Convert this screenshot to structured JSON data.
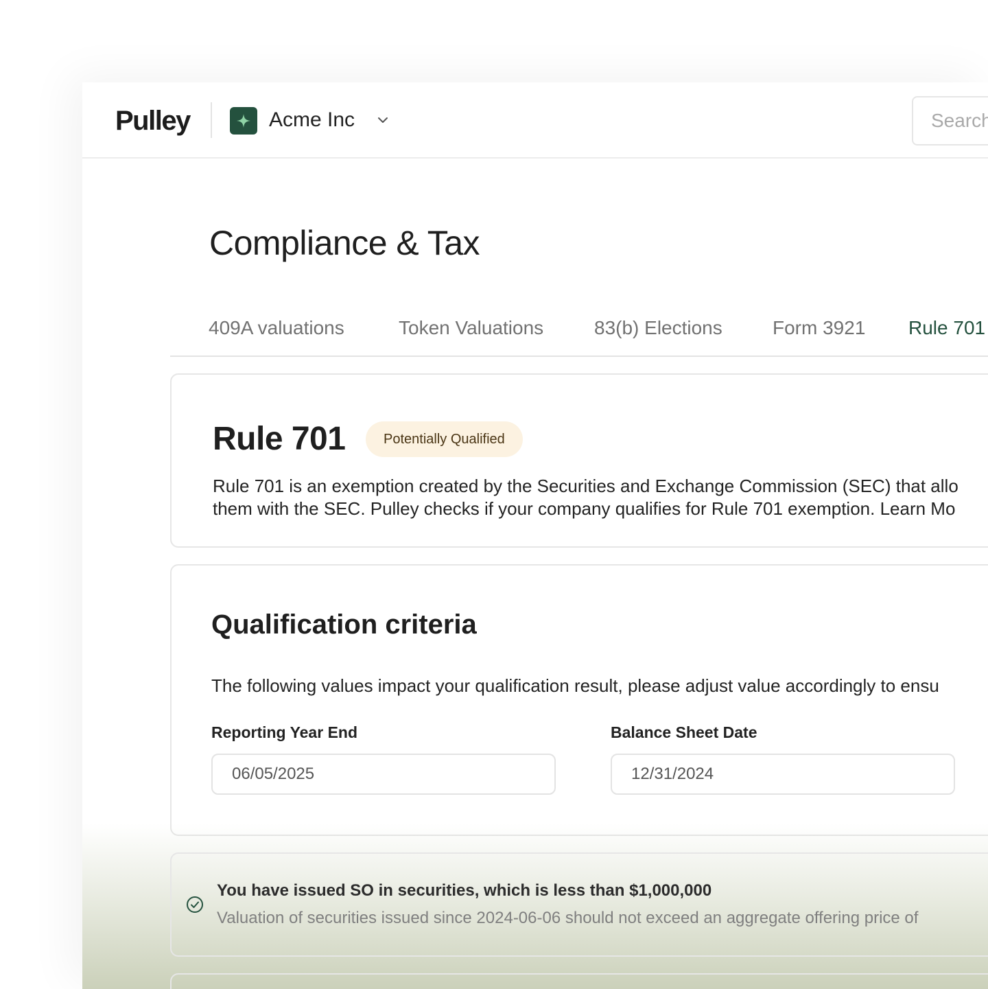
{
  "header": {
    "logo": "Pulley",
    "org_name": "Acme Inc",
    "search_placeholder": "Search"
  },
  "page": {
    "title": "Compliance & Tax"
  },
  "tabs": [
    {
      "label": "409A valuations",
      "active": false
    },
    {
      "label": "Token Valuations",
      "active": false
    },
    {
      "label": "83(b) Elections",
      "active": false
    },
    {
      "label": "Form 3921",
      "active": false
    },
    {
      "label": "Rule 701",
      "active": true
    }
  ],
  "rule_card": {
    "title": "Rule 701",
    "status_badge": "Potentially Qualified",
    "description_line1": "Rule 701 is an exemption created by the Securities and Exchange Commission (SEC) that allo",
    "description_line2": "them with the SEC. Pulley checks if your company qualifies for Rule 701 exemption. Learn Mo"
  },
  "qualification": {
    "title": "Qualification criteria",
    "description": "The following values impact your qualification result, please adjust value accordingly to ensu",
    "fields": [
      {
        "label": "Reporting Year End",
        "value": "06/05/2025"
      },
      {
        "label": "Balance Sheet Date",
        "value": "12/31/2024"
      }
    ]
  },
  "criteria": [
    {
      "title": "You have issued SO in securities, which is less than $1,000,000",
      "subtitle": "Valuation of securities issued since 2024-06-06 should not exceed an aggregate offering price of",
      "status": "passed"
    }
  ],
  "colors": {
    "brand_green": "#24513e",
    "badge_bg": "#fcf2e1",
    "badge_text": "#4a3514"
  }
}
